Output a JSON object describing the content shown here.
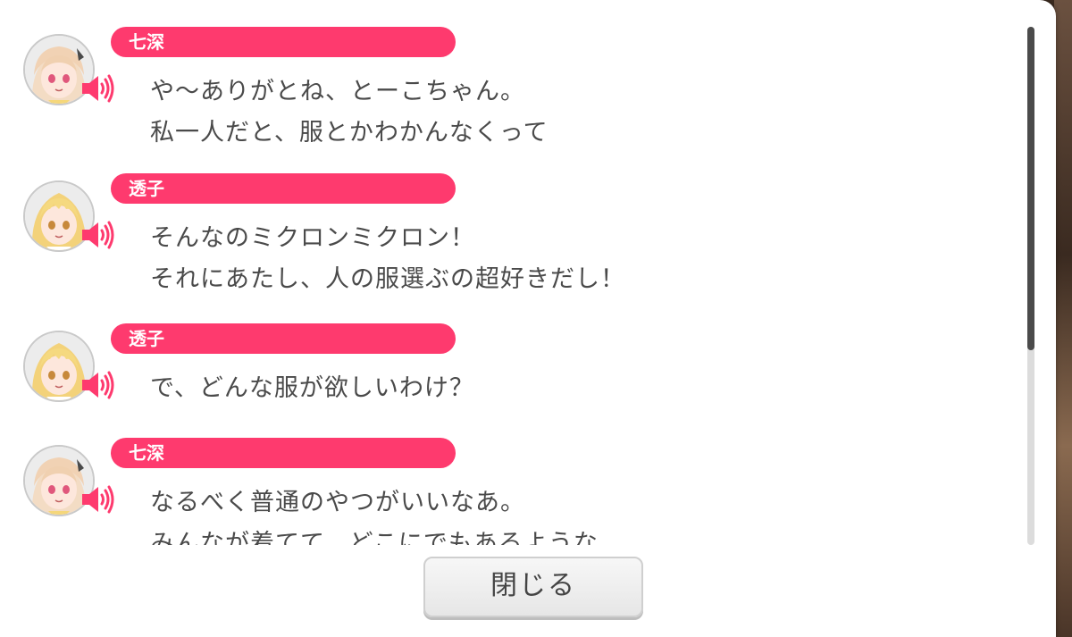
{
  "log_entries": [
    {
      "speaker": "七深",
      "avatar_icon": "nanami-avatar-icon",
      "lines": [
        "や〜ありがとね、とーこちゃん。",
        "私一人だと、服とかわかんなくって"
      ]
    },
    {
      "speaker": "透子",
      "avatar_icon": "toko-avatar-icon",
      "lines": [
        "そんなのミクロンミクロン！",
        "それにあたし、人の服選ぶの超好きだし！"
      ]
    },
    {
      "speaker": "透子",
      "avatar_icon": "toko-avatar-icon",
      "lines": [
        "で、どんな服が欲しいわけ？"
      ]
    },
    {
      "speaker": "七深",
      "avatar_icon": "nanami-avatar-icon",
      "lines": [
        "なるべく普通のやつがいいなあ。",
        "みんなが着てて、どこにでもあるような……"
      ]
    }
  ],
  "close_button_label": "閉じる",
  "colors": {
    "nameplate": "#fe3a6e",
    "voice_icon": "#fe3a6e",
    "text": "#4a4a4a",
    "scroll_thumb": "#4b4b4b"
  }
}
